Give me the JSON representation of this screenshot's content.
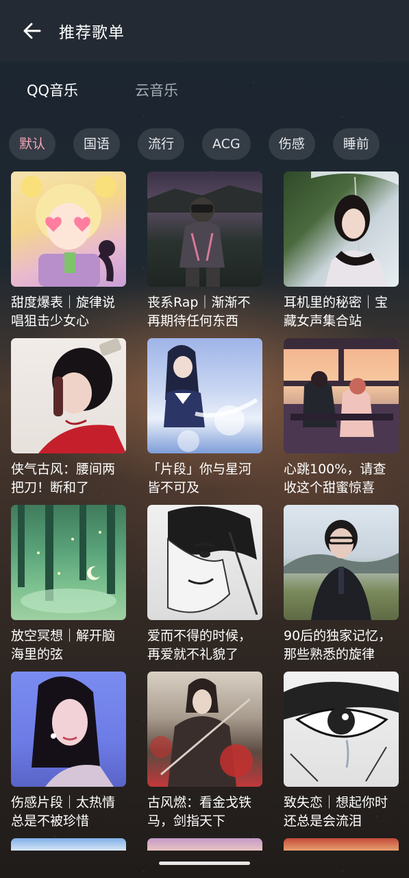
{
  "header": {
    "title": "推荐歌单"
  },
  "tabs": [
    {
      "label": "QQ音乐",
      "active": true
    },
    {
      "label": "云音乐",
      "active": false
    }
  ],
  "categories": [
    {
      "label": "默认",
      "selected": true
    },
    {
      "label": "国语",
      "selected": false
    },
    {
      "label": "流行",
      "selected": false
    },
    {
      "label": "ACG",
      "selected": false
    },
    {
      "label": "伤感",
      "selected": false
    },
    {
      "label": "睡前",
      "selected": false
    }
  ],
  "playlists": [
    {
      "title": "甜度爆表｜旋律说唱狙击少女心",
      "cover": "anime-girl-heart-eyes"
    },
    {
      "title": "丧系Rap｜渐渐不再期待任何东西",
      "cover": "astronaut-night-sky"
    },
    {
      "title": "耳机里的秘密｜宝藏女声集合站",
      "cover": "girl-with-umbrella"
    },
    {
      "title": "侠气古风：腰间两把刀！断和了",
      "cover": "woman-red-hanfu"
    },
    {
      "title": "「片段」你与星河皆不可及",
      "cover": "anime-schoolgirl-sky"
    },
    {
      "title": "心跳100%，请查收这个甜蜜惊喜",
      "cover": "couple-on-train"
    },
    {
      "title": "放空冥想｜解开脑海里的弦",
      "cover": "fireflies-forest"
    },
    {
      "title": "爱而不得的时候，再爱就不礼貌了",
      "cover": "manga-boy-crying"
    },
    {
      "title": "90后的独家记忆，那些熟悉的旋律",
      "cover": "man-in-field"
    },
    {
      "title": "伤感片段｜太热情总是不被珍惜",
      "cover": "woman-blue-background"
    },
    {
      "title": "古风燃：看金戈铁马，剑指天下",
      "cover": "warrior-painting"
    },
    {
      "title": "致失恋｜想起你时还总是会流泪",
      "cover": "manga-eye-tear"
    }
  ]
}
